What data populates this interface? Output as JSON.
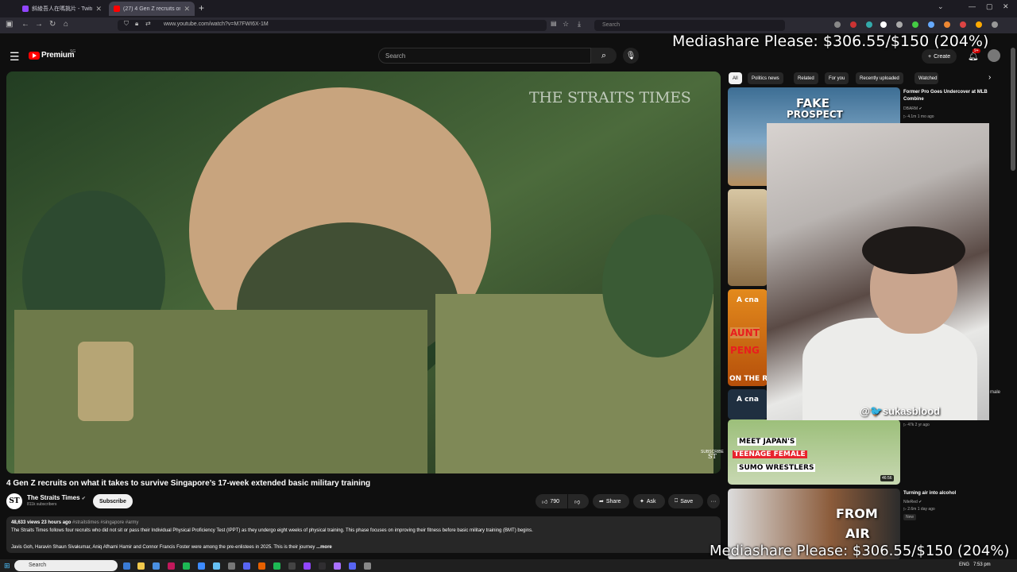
{
  "browser": {
    "tabs": [
      {
        "label": "斜綾吾人在嗎挑片 - Twitch",
        "color": "#9146ff",
        "active": false
      },
      {
        "label": "(27) 4 Gen Z recruits on wh",
        "color": "#ff0000",
        "active": true
      }
    ],
    "new_tab_label": "+",
    "url": "www.youtube.com/watch?v=M7FWI6X-1M",
    "search_placeholder": "Search",
    "window_controls": {
      "minimize": "—",
      "maximize": "▢",
      "close": "✕"
    }
  },
  "overlay": {
    "mediashare_top": "Mediashare Please: $306.55/$150 (204%)",
    "mediashare_bottom": "Mediashare Please: $306.55/$150 (204%)",
    "webcam_handle": "@🐦sukasblood"
  },
  "youtube": {
    "logo_text": "Premium",
    "country_code": "SG",
    "search_placeholder": "Search",
    "create_label": "Create",
    "notification_count": "9+",
    "video": {
      "watermark": "THE STRAITS TIMES",
      "corner_logo": "SUBSCRIBE",
      "corner_logo_mark": "ST",
      "title": "4 Gen Z recruits on what it takes to survive Singapore’s 17-week extended basic military training",
      "channel": "The Straits Times",
      "channel_avatar": "ST",
      "subscribers": "811k subscribers",
      "subscribe_label": "Subscribe",
      "likes": "790",
      "share_label": "Share",
      "ask_label": "Ask",
      "save_label": "Save",
      "more_label": "···",
      "description": {
        "stats": "48,633 views  23 hours ago",
        "tags": "#straitstimes #singapore #army",
        "line1": "The Straits Times follows four recruits who did not sit or pass their Individual Physical Proficiency Test (IPPT) as they undergo eight weeks of physical training. This phase focuses on improving their fitness before basic military training (BMT) begins.",
        "line2": "Javis Goh, Haravin Shaun Sivakumar, Aniq Afhami Hamir and Connor Francis Foster were among the pre-enlistees in 2025. This is their journey",
        "more": "...more"
      }
    },
    "chips": [
      "All",
      "Politics news",
      "Related",
      "For you",
      "Recently uploaded",
      "Watched"
    ],
    "recommended": [
      {
        "thumb_text_1": "FAKE",
        "thumb_text_2": "PROSPECT",
        "title": "Former Pro Goes Undercover at MLB Combine",
        "channel": "DBARM ✔",
        "views": "▷ 4.1m  1 mo ago"
      },
      {
        "thumb_logo": "A cna",
        "thumb_text_1": "AUNT",
        "thumb_text_2": "PENG",
        "thumb_text_3": "ON THE RED"
      },
      {
        "thumb_logo": "A cna",
        "views": "▷ 47k  2 yr ago"
      },
      {
        "thumb_text_1": "MEET JAPAN'S",
        "thumb_text_2": "TEENAGE FEMALE",
        "thumb_text_3": "SUMO WRESTLERS",
        "duration": "46:56",
        "edge_text": "male",
        "edge_text_2": "a"
      },
      {
        "thumb_text_1": "FROM",
        "thumb_text_2": "AIR",
        "title": "Turning air into alcohol",
        "channel": "NileRed ✔",
        "views": "▷ 2.6m  1 day ago",
        "badge": "New"
      }
    ]
  },
  "taskbar": {
    "search_placeholder": "Search",
    "language": "ENG",
    "time": "7:53 pm"
  },
  "colors": {
    "background": "#0f0f0f",
    "youtube_red": "#ff0000",
    "chip_active": "#f1f1f1"
  }
}
